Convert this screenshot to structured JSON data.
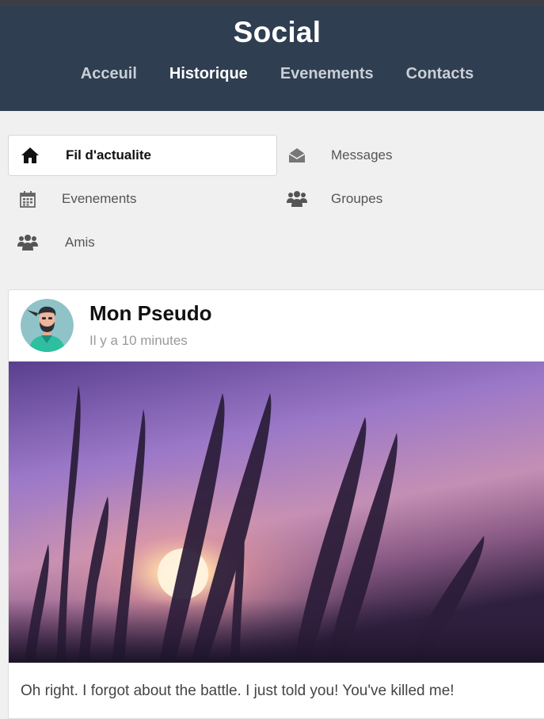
{
  "site": {
    "title": "Social"
  },
  "nav": {
    "items": [
      {
        "label": "Acceuil"
      },
      {
        "label": "Historique"
      },
      {
        "label": "Evenements"
      },
      {
        "label": "Contacts"
      }
    ]
  },
  "menu": {
    "items": [
      {
        "label": "Fil d'actualite",
        "icon": "home-icon"
      },
      {
        "label": "Messages",
        "icon": "envelope-open-icon"
      },
      {
        "label": "Evenements",
        "icon": "calendar-icon"
      },
      {
        "label": "Groupes",
        "icon": "users-icon"
      },
      {
        "label": "Amis",
        "icon": "users-icon"
      }
    ]
  },
  "post": {
    "author": "Mon Pseudo",
    "time": "Il y a 10 minutes",
    "text": "Oh right. I forgot about the battle. I just told you! You've killed me!"
  },
  "colors": {
    "header_bg": "#2f3e51",
    "page_bg": "#f0f0f0"
  }
}
